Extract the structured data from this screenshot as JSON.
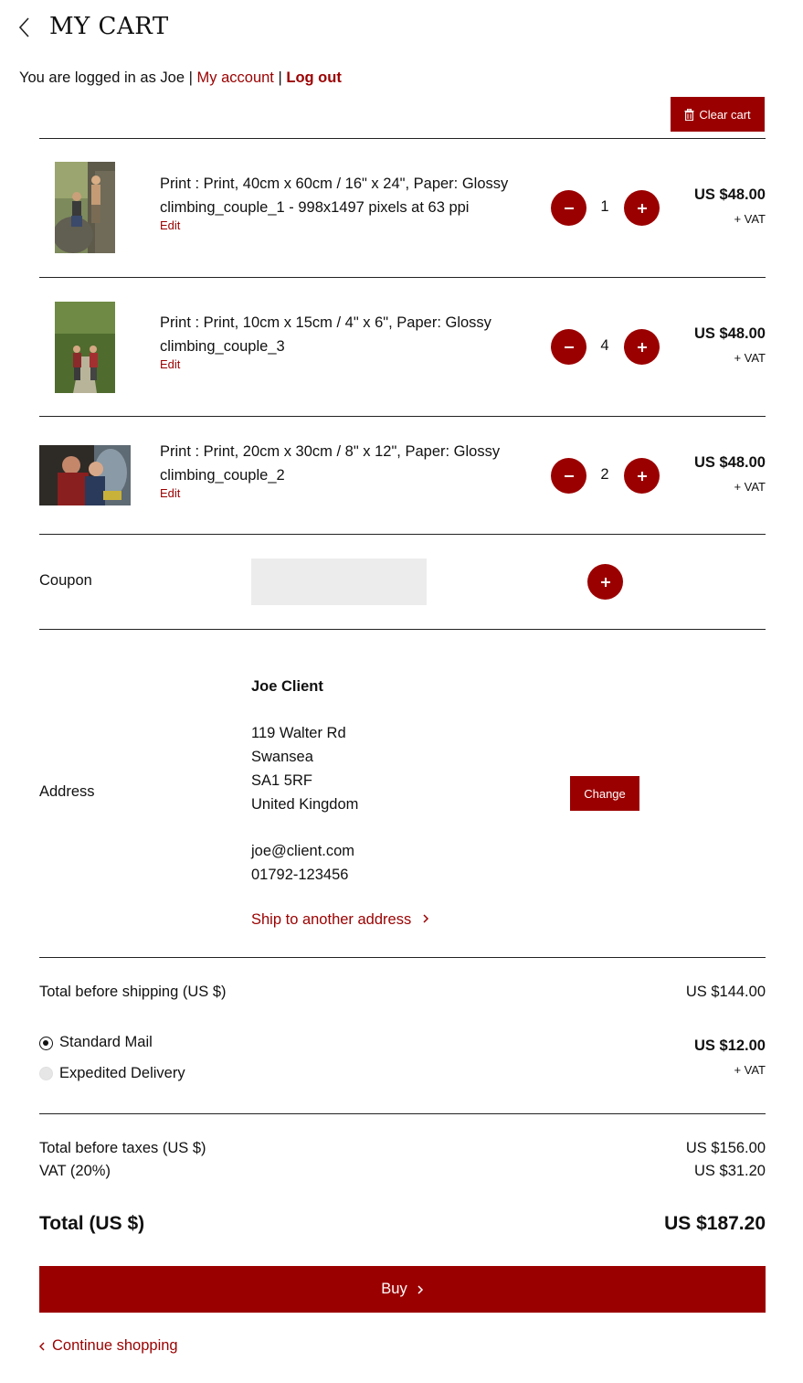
{
  "header": {
    "title": "MY CART"
  },
  "login": {
    "prefix": "You are logged in as Joe",
    "sep1": " | ",
    "account": "My account",
    "sep2": " | ",
    "logout": "Log out"
  },
  "clear_cart": {
    "label": "Clear cart",
    "icon": "trash-icon"
  },
  "items": [
    {
      "line1": "Print : Print, 40cm x 60cm / 16\" x 24\", Paper: Glossy",
      "line2": "climbing_couple_1 - 998x1497 pixels at 63 ppi",
      "edit": "Edit",
      "quantity": "1",
      "price": "US $48.00",
      "vat": "+ VAT",
      "thumb": "climbing-couple-photo"
    },
    {
      "line1": "Print : Print, 10cm x 15cm / 4\" x 6\", Paper: Glossy",
      "line2": "climbing_couple_3",
      "edit": "Edit",
      "quantity": "4",
      "price": "US $48.00",
      "vat": "+ VAT",
      "thumb": "hikers-on-trail-photo"
    },
    {
      "line1": "Print : Print, 20cm x 30cm / 8\" x 12\", Paper: Glossy",
      "line2": "climbing_couple_2",
      "edit": "Edit",
      "quantity": "2",
      "price": "US $48.00",
      "vat": "+ VAT",
      "thumb": "climbers-closeup-photo"
    }
  ],
  "coupon": {
    "label": "Coupon",
    "value": ""
  },
  "address": {
    "label": "Address",
    "name": "Joe Client",
    "street": "119 Walter Rd",
    "city": "Swansea",
    "postcode": "SA1 5RF",
    "country": "United Kingdom",
    "email": "joe@client.com",
    "phone": "01792-123456",
    "change": "Change",
    "ship_other": "Ship to another address"
  },
  "shipping": {
    "total_before_label": "Total before shipping (US $)",
    "total_before_value": "US $144.00",
    "options": [
      {
        "label": "Standard Mail",
        "selected": true
      },
      {
        "label": "Expedited Delivery",
        "selected": false
      }
    ],
    "price": "US $12.00",
    "vat": "+ VAT"
  },
  "totals": {
    "before_taxes_label": "Total before taxes (US $)",
    "before_taxes_value": "US $156.00",
    "vat_label": "VAT (20%)",
    "vat_value": "US $31.20",
    "total_label": "Total (US $)",
    "total_value": "US $187.20"
  },
  "actions": {
    "buy": "Buy",
    "continue": "Continue shopping"
  },
  "colors": {
    "accent": "#9b0000",
    "text": "#111111",
    "input_bg": "#ececec"
  }
}
